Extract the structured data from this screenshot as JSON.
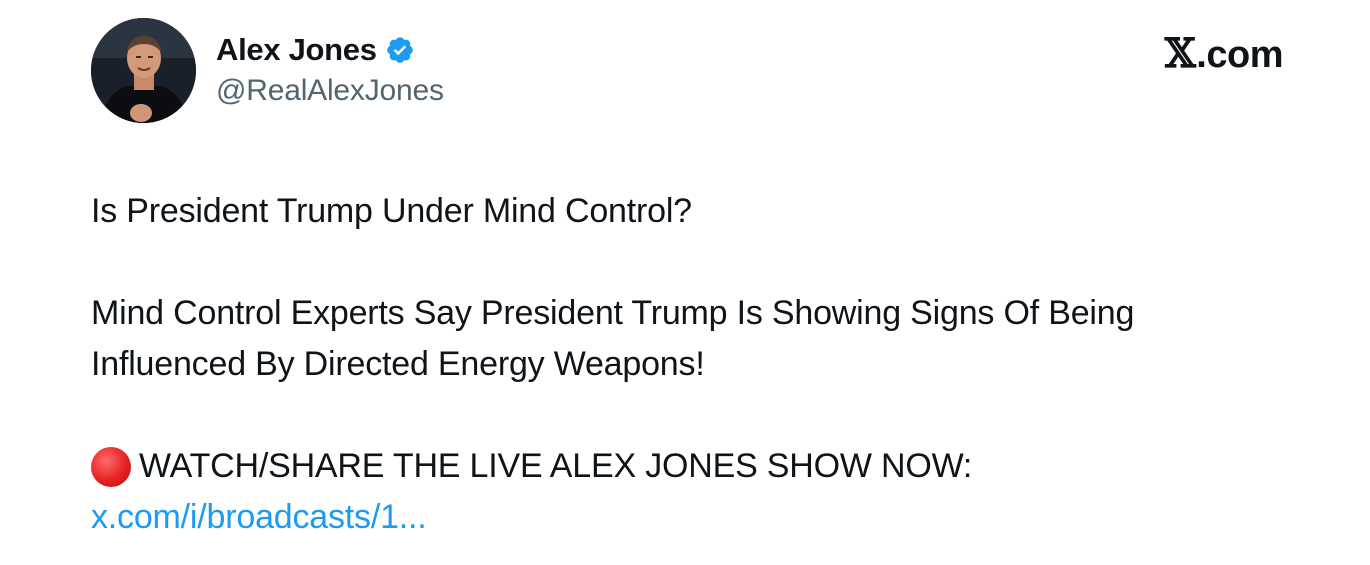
{
  "post": {
    "author": {
      "name": "Alex Jones",
      "handle": "@RealAlexJones",
      "verified": true
    },
    "brand": {
      "mark": "𝕏",
      "text": ".com"
    },
    "lines": {
      "line1": "Is President Trump Under Mind Control?",
      "line2": "Mind Control Experts Say President Trump Is Showing Signs Of Being",
      "line3": "Influenced By Directed Energy Weapons!",
      "live_text": "WATCH/SHARE THE LIVE ALEX JONES SHOW NOW:",
      "link": "x.com/i/broadcasts/1..."
    }
  },
  "icons": {
    "verified": "verified-badge-icon",
    "live": "red-circle-icon",
    "avatar": "profile-photo"
  },
  "colors": {
    "text": "#0f1419",
    "secondary": "#536471",
    "link": "#1d9bf0",
    "verified": "#1d9bf0",
    "live_dot": "#e52222"
  }
}
